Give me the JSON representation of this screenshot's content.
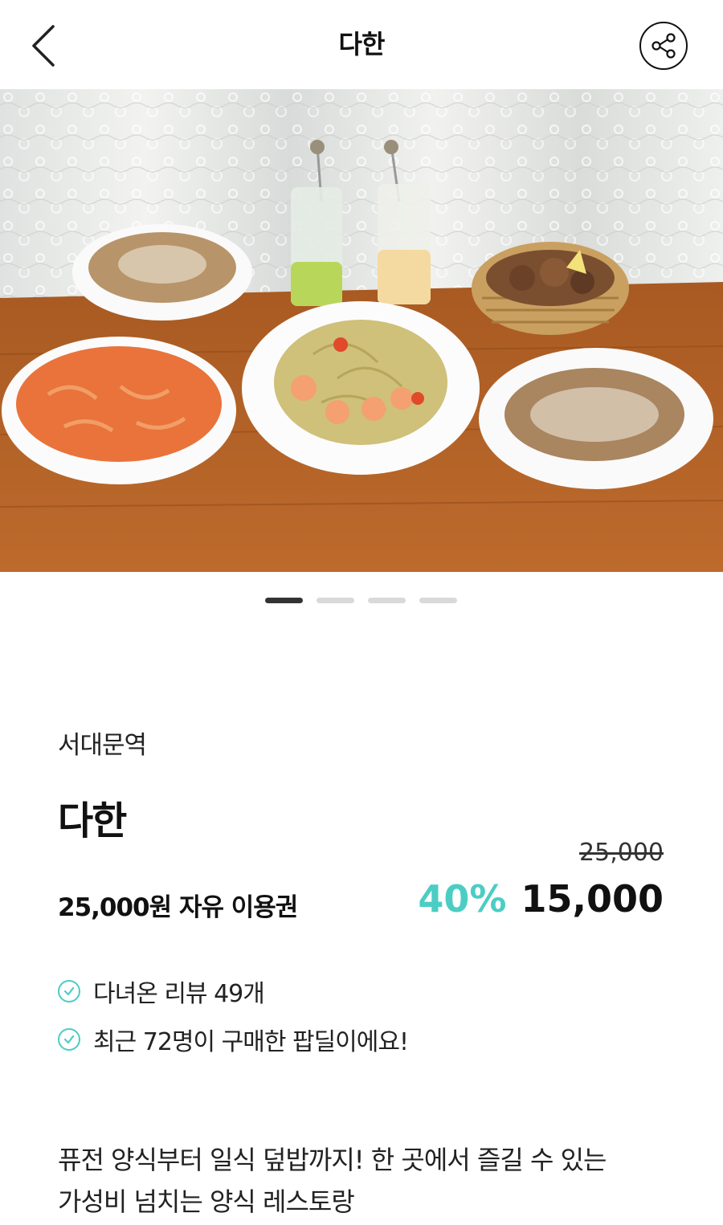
{
  "header": {
    "title": "다한",
    "back_icon": "chevron-left-icon",
    "share_icon": "share-icon"
  },
  "carousel": {
    "total": 4,
    "active_index": 0
  },
  "shop": {
    "station": "서대문역",
    "name": "다한",
    "product_name": "25,000원 자유 이용권",
    "original_price": "25,000",
    "discount": "40%",
    "sale_price": "15,000"
  },
  "badges": [
    {
      "text": "다녀온 리뷰 49개"
    },
    {
      "text": "최근 72명이 구매한 팝딜이에요!"
    }
  ],
  "description": {
    "line1": "퓨전 양식부터 일식 덮밥까지! 한 곳에서 즐길 수 있는",
    "line2": "가성비 넘치는 양식 레스토랑"
  },
  "colors": {
    "accent": "#4ccdc4",
    "text": "#111111",
    "dot_active": "#333333",
    "dot_inactive": "#d9d9d9"
  }
}
